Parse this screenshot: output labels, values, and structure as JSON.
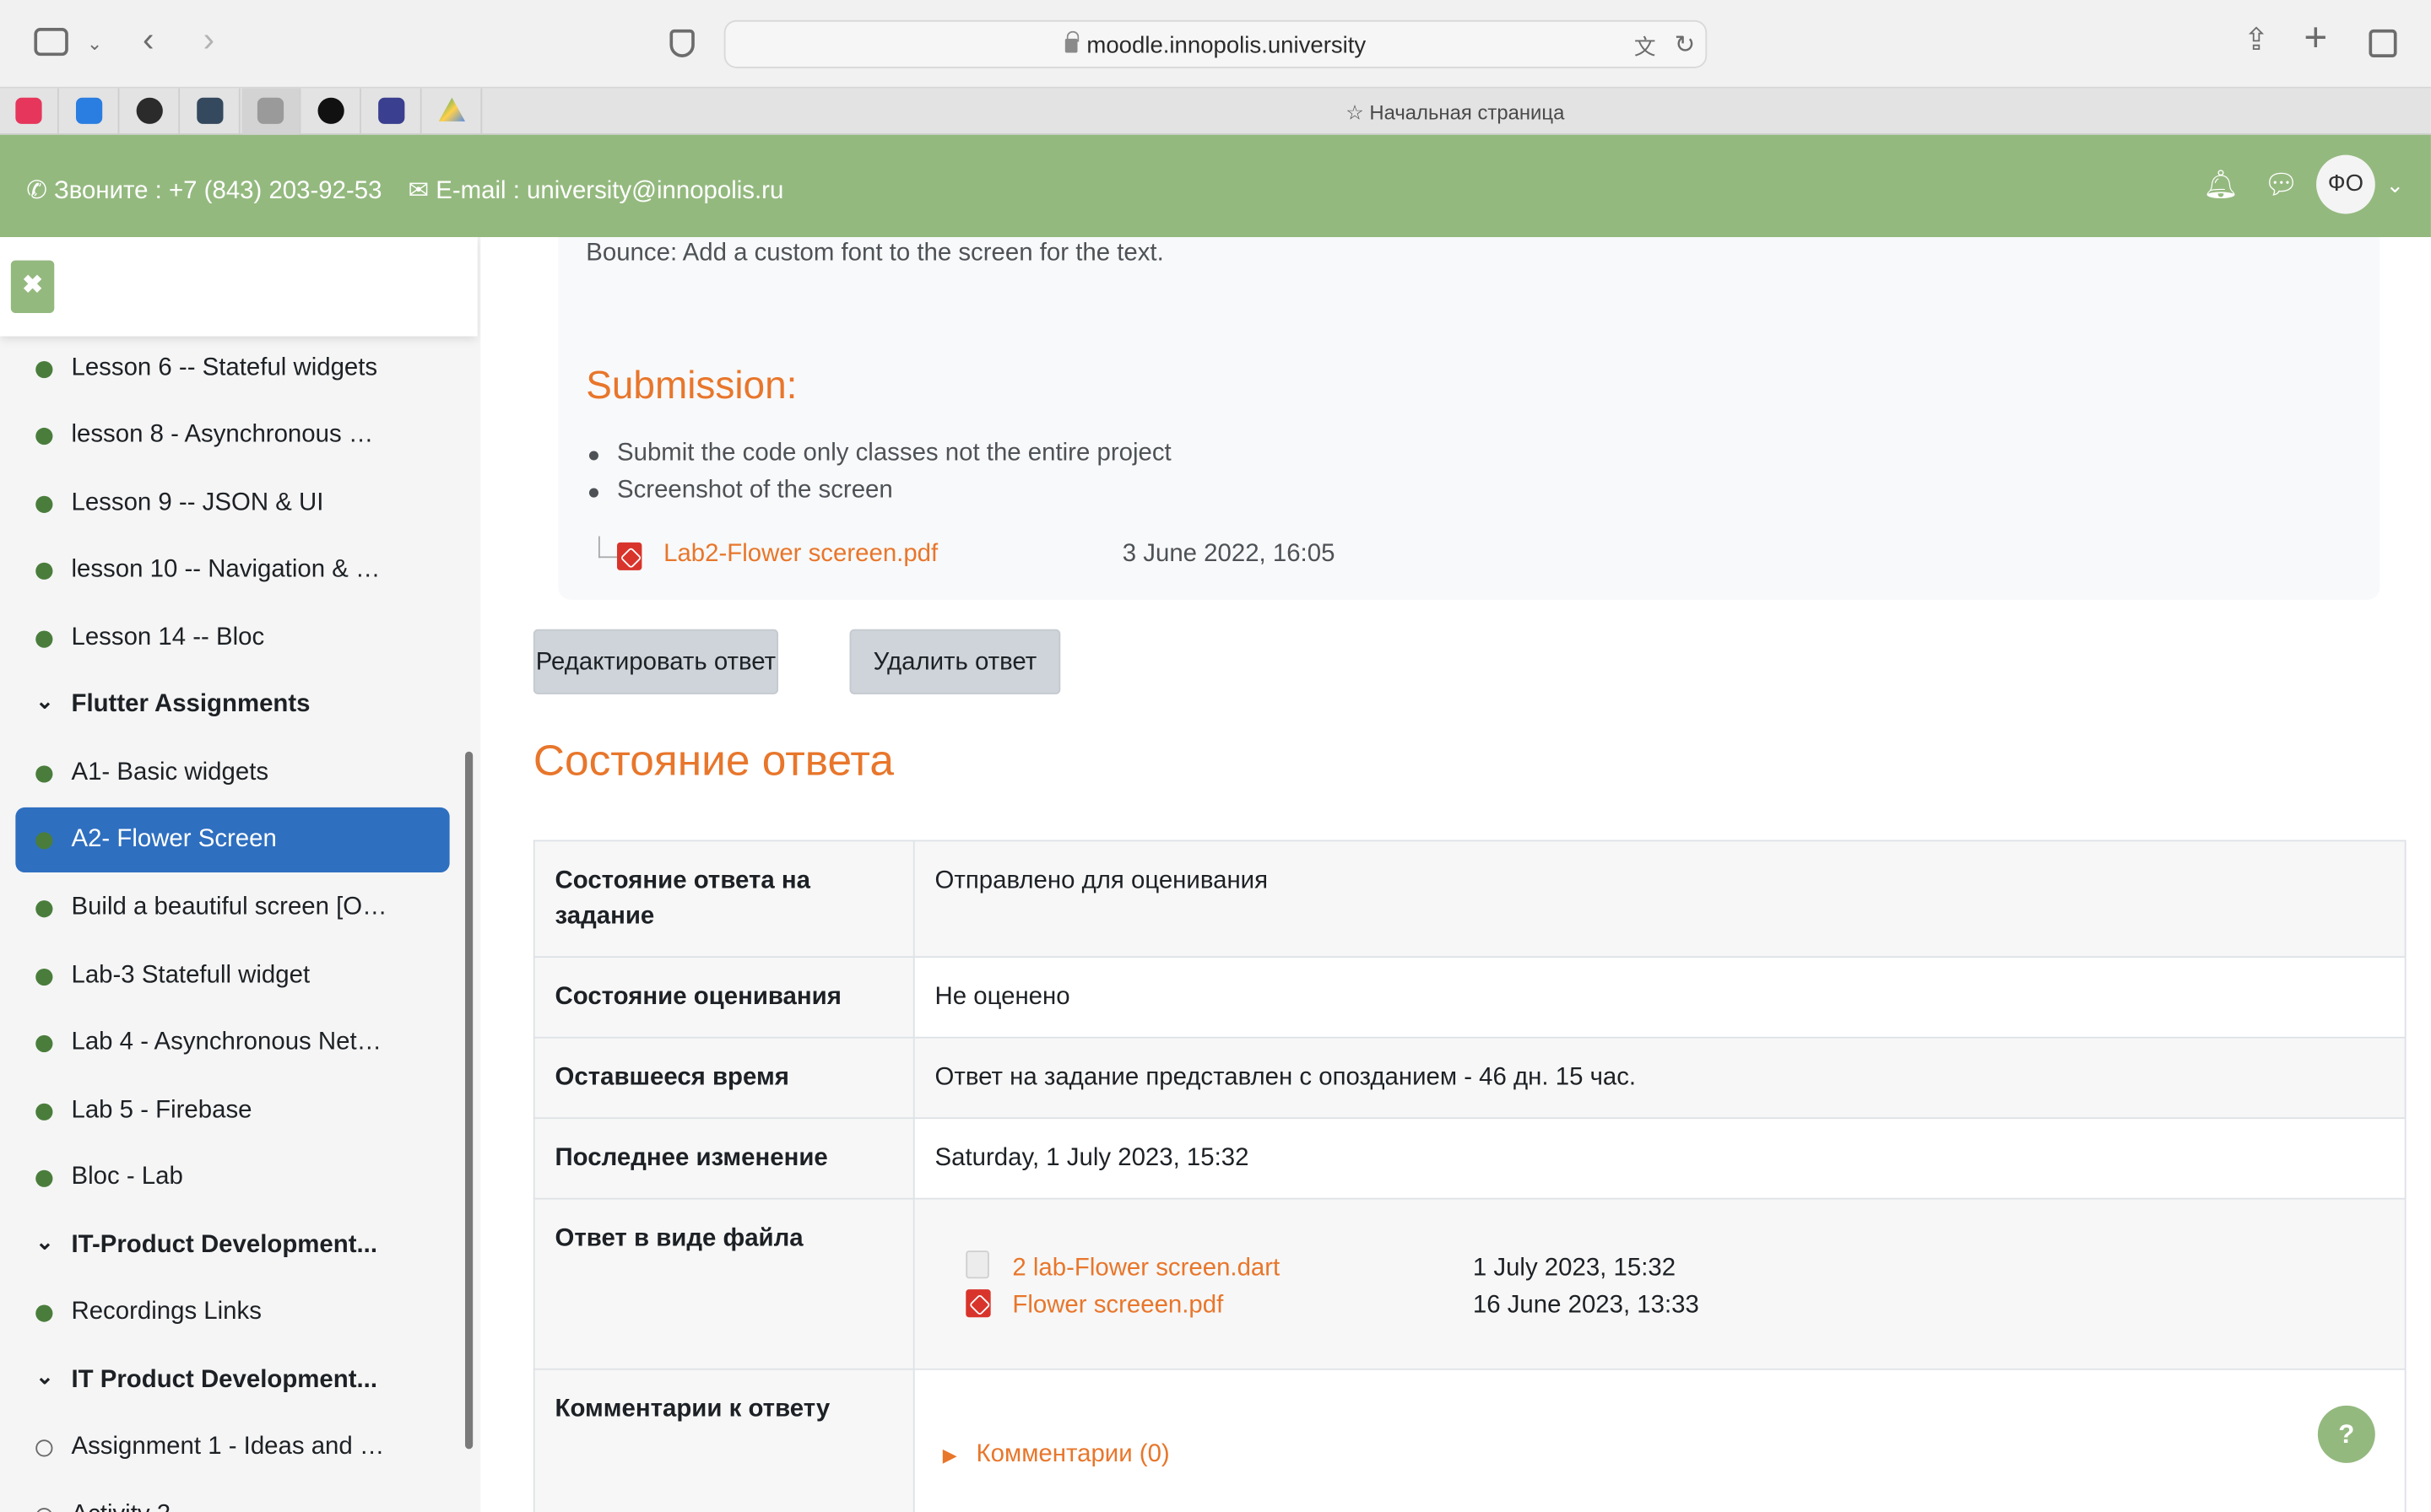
{
  "browser": {
    "url": "moodle.innopolis.university",
    "tab_title": "Начальная страница"
  },
  "header": {
    "phone": "Звоните : +7 (843) 203-92-53",
    "email": "E-mail : university@innopolis.ru",
    "avatar_initials": "ФО"
  },
  "sidebar": {
    "close_label": "✖",
    "items": [
      {
        "label": "Lesson 6 -- Stateful widgets"
      },
      {
        "label": "lesson 8 - Asynchronous …"
      },
      {
        "label": "Lesson 9 -- JSON & UI"
      },
      {
        "label": "lesson 10 -- Navigation & …"
      },
      {
        "label": "Lesson 14 -- Bloc"
      },
      {
        "label": "Flutter Assignments"
      },
      {
        "label": "A1- Basic widgets"
      },
      {
        "label": "A2- Flower Screen"
      },
      {
        "label": "Build a beautiful screen [O…"
      },
      {
        "label": "Lab-3 Statefull widget"
      },
      {
        "label": "Lab 4 - Asynchronous Net…"
      },
      {
        "label": "Lab 5 - Firebase"
      },
      {
        "label": "Bloc - Lab"
      },
      {
        "label": "IT-Product Development..."
      },
      {
        "label": "Recordings Links"
      },
      {
        "label": "IT Product Development..."
      },
      {
        "label": "Assignment 1 - Ideas and …"
      },
      {
        "label": "Activity 2"
      }
    ]
  },
  "assignment": {
    "bounce_text": "Bounce: Add a custom font to the screen for the text.",
    "submission_heading": "Submission:",
    "bullets": [
      "Submit the code only classes not the entire project",
      "Screenshot of the screen"
    ],
    "attachment": {
      "name": "Lab2-Flower scereen.pdf",
      "date": "3 June 2022, 16:05"
    }
  },
  "actions": {
    "edit_label": "Редактировать ответ",
    "delete_label": "Удалить ответ"
  },
  "status": {
    "heading": "Состояние ответа",
    "rows": [
      {
        "key": "Состояние ответа на задание",
        "value": "Отправлено для оценивания"
      },
      {
        "key": "Состояние оценивания",
        "value": "Не оценено"
      },
      {
        "key": "Оставшееся время",
        "value": "Ответ на задание представлен с опозданием - 46 дн. 15 час."
      },
      {
        "key": "Последнее изменение",
        "value": "Saturday, 1 July 2023, 15:32"
      },
      {
        "key": "Ответ в виде файла"
      },
      {
        "key": "Комментарии к ответу"
      }
    ],
    "files": [
      {
        "name": "2 lab-Flower screen.dart",
        "date": "1 July 2023, 15:32"
      },
      {
        "name": "Flower screeen.pdf",
        "date": "16 June 2023, 13:33"
      }
    ],
    "comments_label": "Комментарии (0)"
  },
  "help_label": "?",
  "colors": {
    "brand": "#94b97f",
    "accent": "#e8762b",
    "active": "#2e6fc0"
  }
}
